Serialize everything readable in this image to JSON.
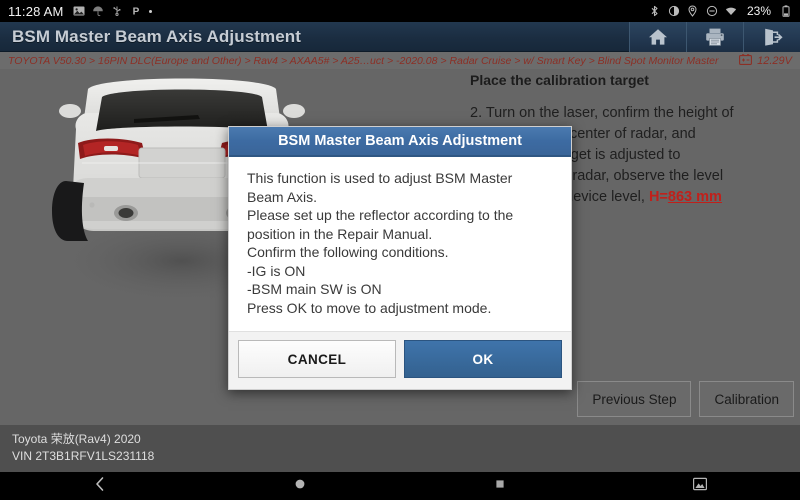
{
  "status_bar": {
    "clock": "11:28 AM",
    "battery_percent": "23%",
    "left_icons": [
      "image-icon",
      "weather-icon",
      "usb-icon",
      "parking-icon",
      "more-dot-icon"
    ],
    "right_icons": [
      "bluetooth-icon",
      "brightness-icon",
      "location-icon",
      "do-not-disturb-icon",
      "wifi-icon"
    ]
  },
  "title_bar": {
    "app_title": "BSM Master Beam Axis Adjustment",
    "buttons": [
      {
        "name": "home-button",
        "icon": "home-icon"
      },
      {
        "name": "print-button",
        "icon": "printer-icon"
      },
      {
        "name": "exit-button",
        "icon": "exit-icon"
      }
    ]
  },
  "breadcrumb": {
    "path": "TOYOTA V50.30 > 16PIN DLC(Europe and Other) > Rav4 > AXAA5# > A25…uct > -2020.08 > Radar Cruise > w/ Smart Key > Blind Spot Monitor Master",
    "battery_icon": "car-battery-icon",
    "voltage": "12.29V"
  },
  "main": {
    "vehicle_image_alt": "rear-view-suv",
    "instructions": {
      "heading": "Place the calibration target",
      "line1": "2. Turn on the laser, confirm the height of",
      "line2": "the laser at the center of radar, and",
      "line3": "the height of target is adjusted to",
      "line4": "same height as radar, observe the level",
      "line5": "and adjust the device level,",
      "h_label": "H=",
      "h_value": "863 mm"
    },
    "actions": [
      {
        "name": "previous-step-button",
        "label": "Previous Step"
      },
      {
        "name": "calibration-button",
        "label": "Calibration"
      }
    ]
  },
  "footer": {
    "vehicle": "Toyota 荣放(Rav4) 2020",
    "vin": "VIN 2T3B1RFV1LS231118"
  },
  "nav_bar": {
    "buttons": [
      {
        "name": "nav-back-button",
        "icon": "chevron-left-icon"
      },
      {
        "name": "nav-home-button",
        "icon": "circle-icon"
      },
      {
        "name": "nav-recents-button",
        "icon": "square-icon"
      },
      {
        "name": "nav-screenshot-button",
        "icon": "screenshot-icon"
      }
    ]
  },
  "dialog": {
    "title": "BSM Master Beam Axis Adjustment",
    "line1": "This function is used to adjust BSM Master",
    "line2": "Beam Axis.",
    "line3": "Please set up the reflector according to the",
    "line4": "position in the Repair Manual.",
    "line5": "Confirm the following conditions.",
    "line6": "-IG is ON",
    "line7": "-BSM main SW is ON",
    "line8": "Press OK to move to adjustment mode.",
    "cancel_label": "CANCEL",
    "ok_label": "OK"
  },
  "colors": {
    "header_navy": "#1b2d41",
    "breadcrumb_bg": "#6c6c6c",
    "breadcrumb_text": "#8c2f25",
    "content_bg": "#666666",
    "footer_bg": "#4f4f4f",
    "dialog_title_blue": "#3d6ba2",
    "ok_blue": "#33618f",
    "accent_red": "#c0201b"
  }
}
